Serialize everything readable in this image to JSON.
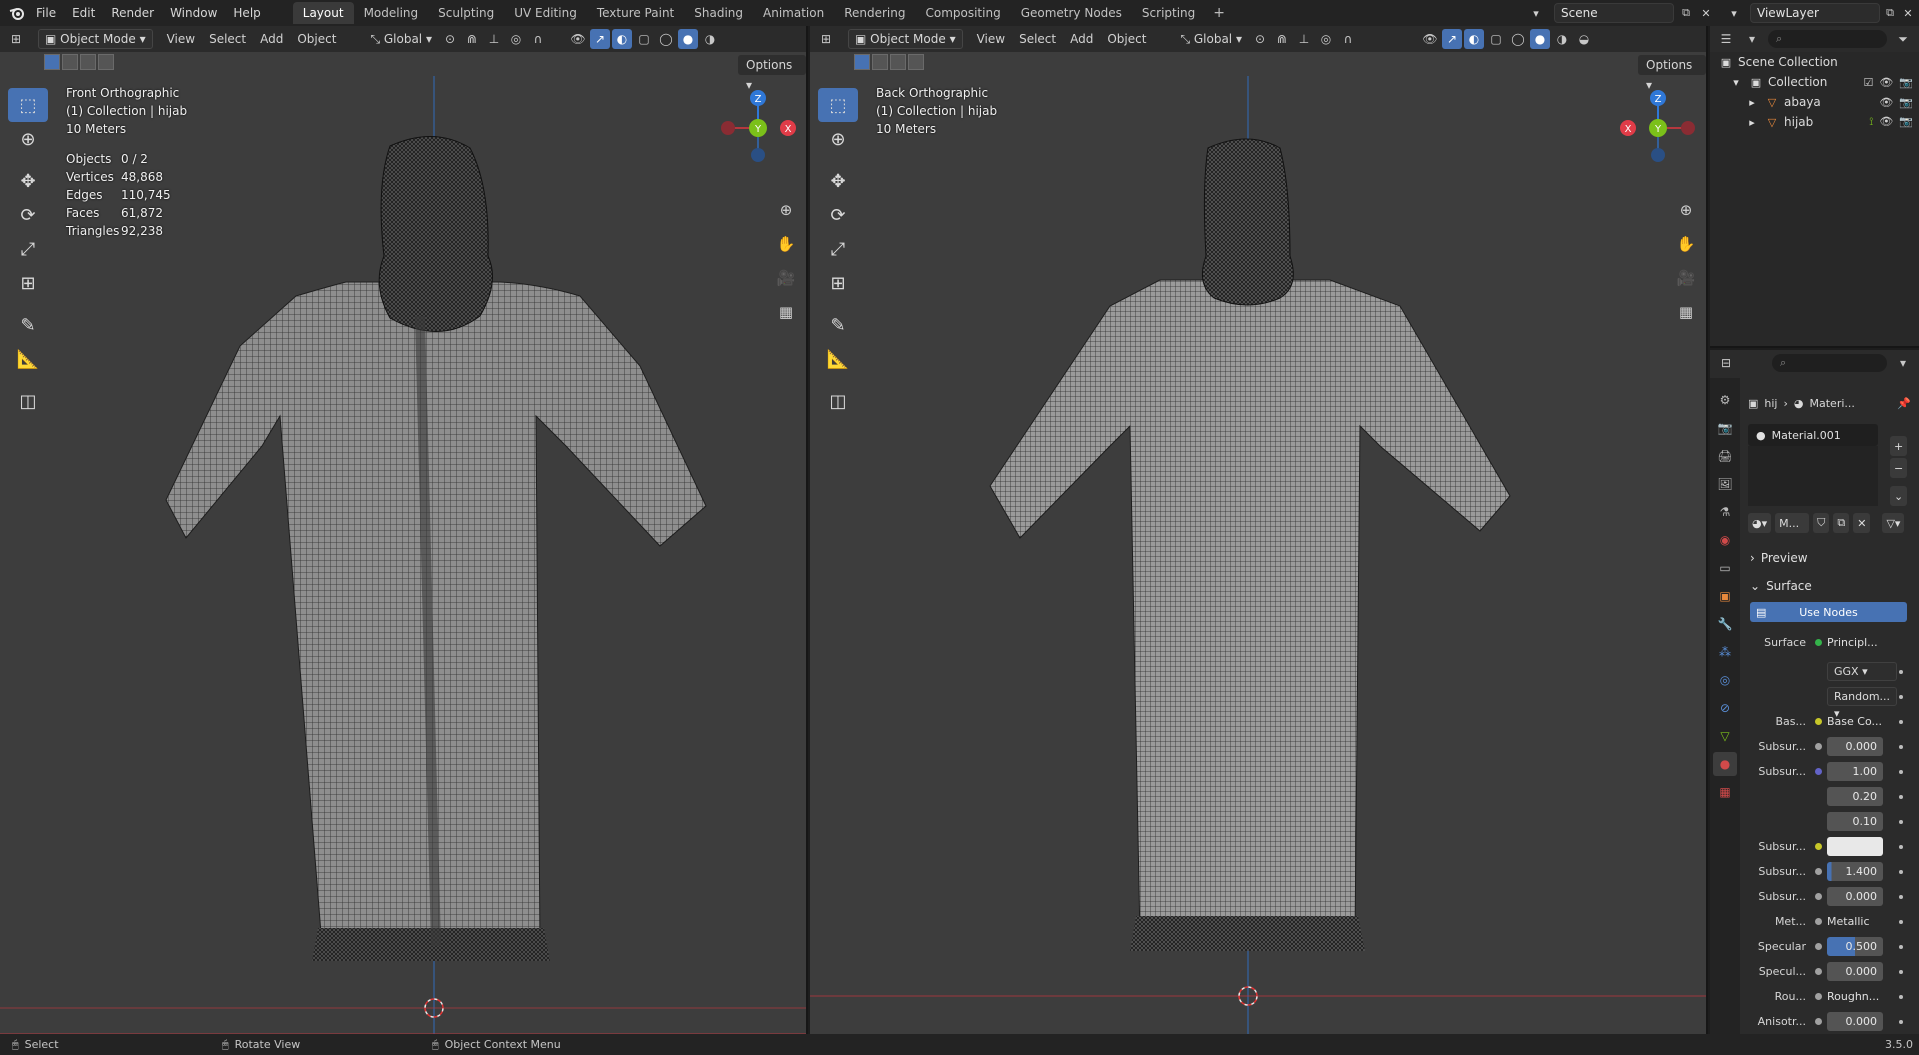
{
  "menu": {
    "items": [
      "File",
      "Edit",
      "Render",
      "Window",
      "Help"
    ]
  },
  "workspaces": {
    "tabs": [
      "Layout",
      "Modeling",
      "Sculpting",
      "UV Editing",
      "Texture Paint",
      "Shading",
      "Animation",
      "Rendering",
      "Compositing",
      "Geometry Nodes",
      "Scripting"
    ],
    "active": "Layout",
    "add": "+"
  },
  "scene": {
    "label": "Scene"
  },
  "view_layer": {
    "label": "ViewLayer"
  },
  "viewport_left": {
    "mode": "Object Mode",
    "menus": [
      "View",
      "Select",
      "Add",
      "Object"
    ],
    "transform": "Global",
    "options": "Options",
    "view_name": "Front Orthographic",
    "collection": "(1) Collection | hijab",
    "scale": "10 Meters",
    "stats": [
      {
        "key": "Objects",
        "value": "0 / 2"
      },
      {
        "key": "Vertices",
        "value": "48,868"
      },
      {
        "key": "Edges",
        "value": "110,745"
      },
      {
        "key": "Faces",
        "value": "61,872"
      },
      {
        "key": "Triangles",
        "value": "92,238"
      }
    ],
    "gizmo": {
      "z": "Z",
      "y": "Y",
      "x": "X"
    }
  },
  "viewport_right": {
    "mode": "Object Mode",
    "menus": [
      "View",
      "Select",
      "Add",
      "Object"
    ],
    "transform": "Global",
    "options": "Options",
    "view_name": "Back Orthographic",
    "collection": "(1) Collection | hijab",
    "scale": "10 Meters",
    "gizmo": {
      "z": "Z",
      "y": "Y",
      "x": "X"
    }
  },
  "outliner": {
    "root": "Scene Collection",
    "collection": "Collection",
    "objects": [
      "abaya",
      "hijab"
    ]
  },
  "properties": {
    "crumb_object": "hij",
    "crumb_material": "Materi...",
    "material_slot": "Material.001",
    "material_short": "M...",
    "panel_preview": "Preview",
    "panel_surface": "Surface",
    "use_nodes": "Use Nodes",
    "surface_label": "Surface",
    "surface_value": "Principl...",
    "distribution": "GGX",
    "subsurface_method": "Random...",
    "rows": [
      {
        "label": "Bas...",
        "value": "Base Co...",
        "kind": "link",
        "sock": "#c7c729"
      },
      {
        "label": "Subsur...",
        "value": "0.000",
        "kind": "num",
        "sock": "#a1a1a1"
      },
      {
        "label": "Subsur...",
        "value": "1.00",
        "kind": "num",
        "sock": "#6363c7"
      },
      {
        "label": "",
        "value": "0.20",
        "kind": "num",
        "sock": ""
      },
      {
        "label": "",
        "value": "0.10",
        "kind": "num",
        "sock": ""
      },
      {
        "label": "Subsur...",
        "value": "",
        "kind": "color",
        "sock": "#c7c729"
      },
      {
        "label": "Subsur...",
        "value": "1.400",
        "kind": "num",
        "sock": "#a1a1a1"
      },
      {
        "label": "Subsur...",
        "value": "0.000",
        "kind": "num",
        "sock": "#a1a1a1"
      },
      {
        "label": "Met...",
        "value": "Metallic",
        "kind": "link",
        "sock": "#a1a1a1"
      },
      {
        "label": "Specular",
        "value": "0.500",
        "kind": "num",
        "sock": "#a1a1a1"
      },
      {
        "label": "Specul...",
        "value": "0.000",
        "kind": "num",
        "sock": "#a1a1a1"
      },
      {
        "label": "Rou...",
        "value": "Roughn...",
        "kind": "link",
        "sock": "#a1a1a1"
      },
      {
        "label": "Anisotr...",
        "value": "0.000",
        "kind": "num",
        "sock": "#a1a1a1"
      }
    ]
  },
  "statusbar": {
    "select": "Select",
    "rotate": "Rotate View",
    "context": "Object Context Menu",
    "version": "3.5.0"
  },
  "colors": {
    "accent": "#4772b3",
    "viewport_bg": "#3d3d3d",
    "x_axis": "#e03c48",
    "y_axis": "#7bc01a",
    "z_axis": "#2f78d8"
  }
}
